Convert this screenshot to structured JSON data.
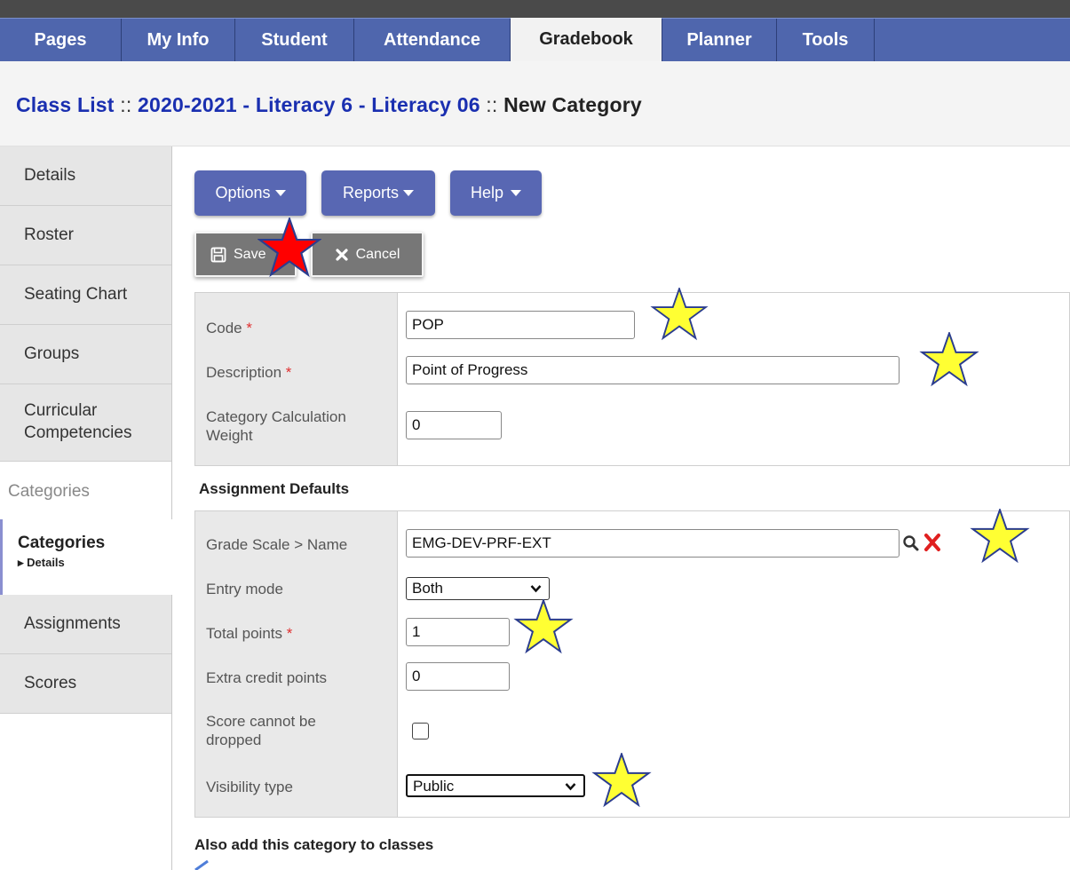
{
  "tabs": [
    "Pages",
    "My Info",
    "Student",
    "Attendance",
    "Gradebook",
    "Planner",
    "Tools"
  ],
  "active_tab": "Gradebook",
  "breadcrumb": {
    "class_list": "Class List",
    "sep1": " :: ",
    "course": "2020-2021 - Literacy 6 - Literacy 06",
    "sep2": " :: ",
    "current": "New Category"
  },
  "sidebar": {
    "items_top": [
      "Details",
      "Roster",
      "Seating Chart",
      "Groups",
      "Curricular Competencies"
    ],
    "section_header": "Categories",
    "active_item": "Categories",
    "active_subitem": "Details",
    "items_bottom": [
      "Assignments",
      "Scores"
    ]
  },
  "toolbar": {
    "options": "Options",
    "reports": "Reports",
    "help": "Help",
    "save": "Save",
    "cancel": "Cancel"
  },
  "form": {
    "code_label": "Code",
    "code_value": "POP",
    "description_label": "Description",
    "description_value": "Point of Progress",
    "weight_label": "Category Calculation Weight",
    "weight_value": "0",
    "required_mark": "*"
  },
  "assignment_defaults": {
    "heading": "Assignment Defaults",
    "grade_scale_label": "Grade Scale > Name",
    "grade_scale_value": "EMG-DEV-PRF-EXT",
    "entry_mode_label": "Entry mode",
    "entry_mode_value": "Both",
    "total_points_label": "Total points",
    "total_points_value": "1",
    "extra_credit_label": "Extra credit points",
    "extra_credit_value": "0",
    "score_dropped_label": "Score cannot be dropped",
    "visibility_label": "Visibility type",
    "visibility_value": "Public"
  },
  "also_add_heading": "Also add this category to classes",
  "colors": {
    "tab_bar": "#4f66ad",
    "link": "#1a2fb0",
    "star_yellow": "#ffff33",
    "star_red": "#ff0000",
    "delete_x": "#e02020"
  }
}
